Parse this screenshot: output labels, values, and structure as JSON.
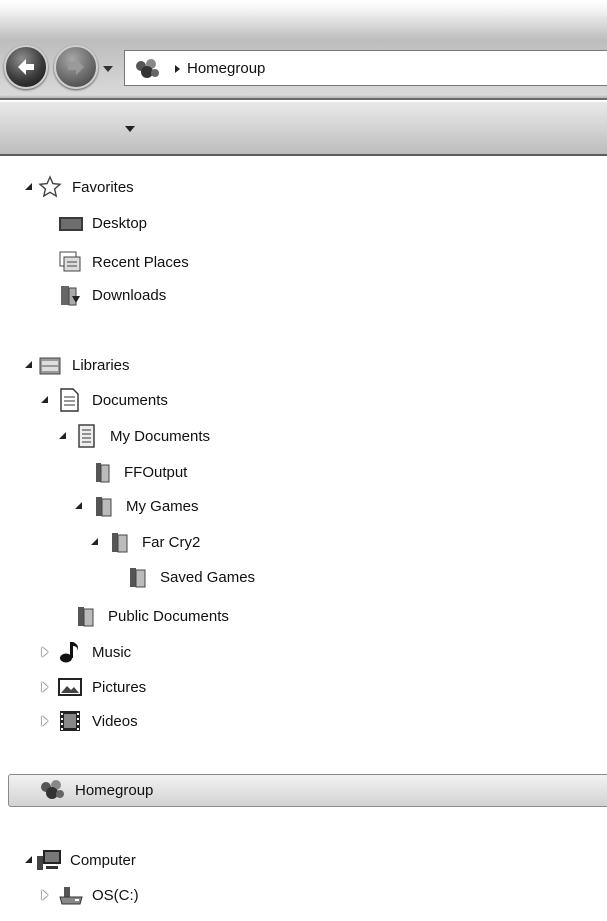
{
  "address_bar": {
    "breadcrumb": "Homegroup"
  },
  "nav_tree": {
    "favorites": {
      "label": "Favorites",
      "items": [
        "Desktop",
        "Recent Places",
        "Downloads"
      ]
    },
    "libraries": {
      "label": "Libraries",
      "documents": "Documents",
      "my_documents": "My Documents",
      "ffoutput": "FFOutput",
      "my_games": "My Games",
      "far_cry2": "Far Cry2",
      "saved_games": "Saved Games",
      "public_documents": "Public Documents",
      "music": "Music",
      "pictures": "Pictures",
      "videos": "Videos"
    },
    "homegroup": {
      "label": "Homegroup",
      "selected": true
    },
    "computer": {
      "label": "Computer",
      "drive": "OS(C:)"
    }
  },
  "icons": {
    "back": "back-arrow-icon",
    "forward": "forward-arrow-icon",
    "homegroup": "homegroup-icon",
    "favorites": "star-icon",
    "desktop": "desktop-icon",
    "recent_places": "recent-places-icon",
    "downloads": "downloads-folder-icon",
    "libraries": "libraries-icon",
    "documents": "document-icon",
    "folder": "folder-icon",
    "music": "music-note-icon",
    "pictures": "picture-icon",
    "videos": "film-icon",
    "computer": "computer-monitor-icon",
    "drive": "hard-drive-icon"
  }
}
